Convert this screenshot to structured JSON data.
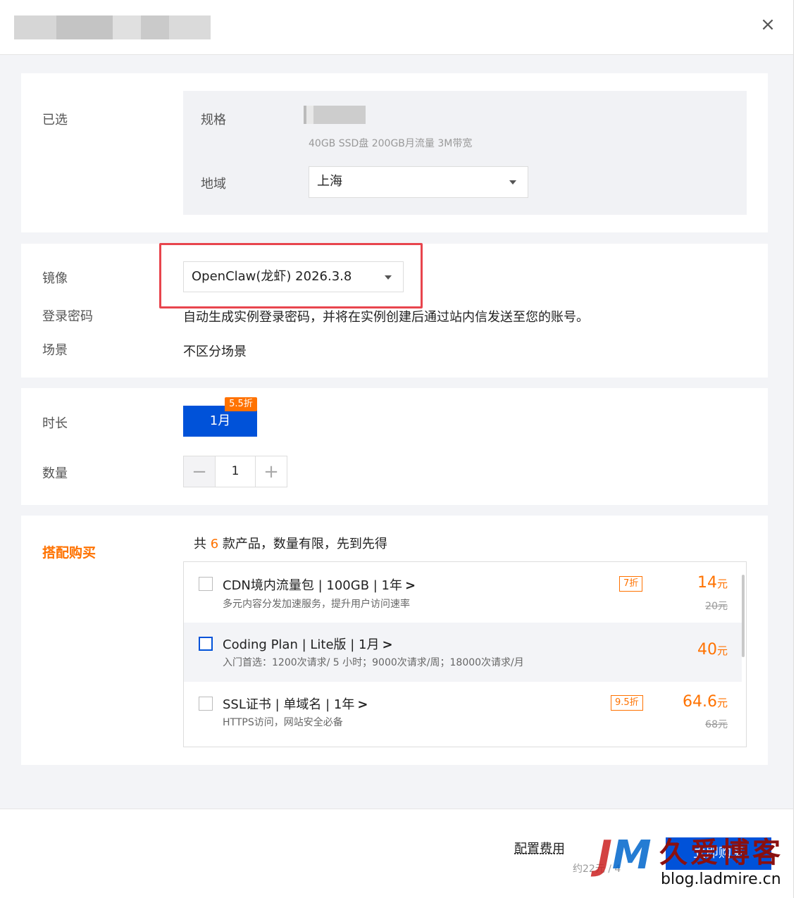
{
  "header": {
    "close_symbol": "×"
  },
  "selected": {
    "label": "已选",
    "spec_label": "规格",
    "spec_desc": "40GB SSD盘 200GB月流量 3M带宽",
    "region_label": "地域",
    "region_value": "上海"
  },
  "image": {
    "label": "镜像",
    "value": "OpenClaw(龙虾) 2026.3.8",
    "password_label": "登录密码",
    "password_text": "自动生成实例登录密码，并将在实例创建后通过站内信发送至您的账号。",
    "scene_label": "场景",
    "scene_text": "不区分场景"
  },
  "duration": {
    "label": "时长",
    "option": "1月",
    "discount": "5.5折",
    "quantity_label": "数量",
    "quantity": "1",
    "minus_symbol": "−",
    "plus_symbol": "+"
  },
  "bundle": {
    "title": "搭配购买",
    "desc_prefix": "共 ",
    "desc_count": "6",
    "desc_suffix": " 款产品，数量有限，先到先得",
    "items": [
      {
        "name": "CDN境内流量包 | 100GB | 1年",
        "sub": "多元内容分发加速服务，提升用户访问速率",
        "tag": "7折",
        "price": "14",
        "unit": "元",
        "orig": "20元"
      },
      {
        "name": "Coding Plan | Lite版 | 1月",
        "sub": "入门首选：1200次请求/ 5 小时；9000次请求/周；18000次请求/月",
        "price": "40",
        "unit": "元"
      },
      {
        "name": "SSL证书 | 单域名 | 1年",
        "sub": "HTTPS访问，网站安全必备",
        "tag": "9.5折",
        "price": "64.6",
        "unit": "元",
        "orig": "68元"
      }
    ],
    "chevron": ">"
  },
  "footer": {
    "fee_label": "配置费用",
    "fee_approx": "约22元 / 4",
    "buy_label": "立即购买"
  },
  "watermark": {
    "logo_j": "J",
    "logo_m": "M",
    "text": "久爱博客",
    "url": "blog.ladmire.cn"
  },
  "colors": {
    "primary": "#0052d9",
    "accent": "#ff7200",
    "highlight": "#e8454d"
  }
}
